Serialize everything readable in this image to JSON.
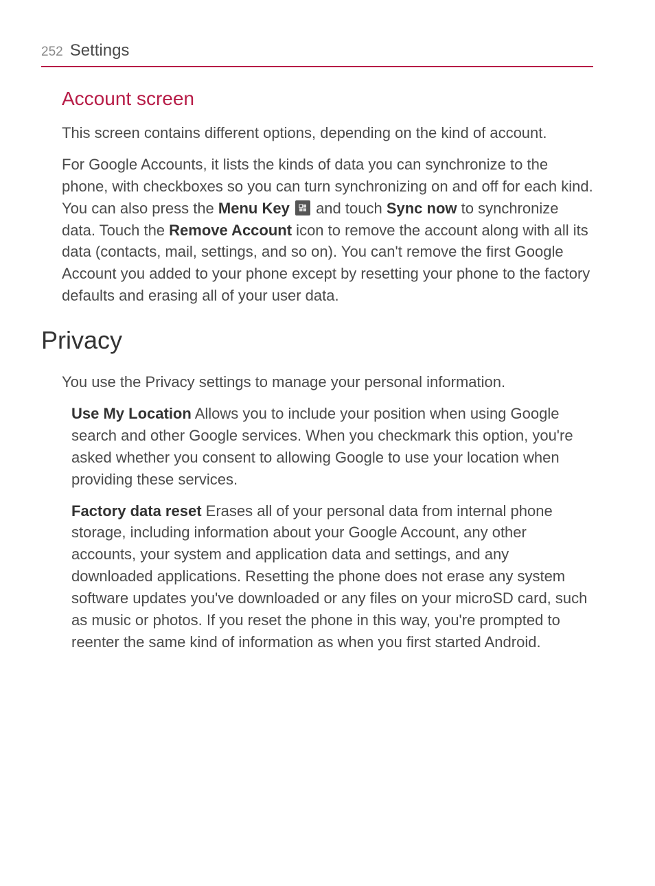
{
  "header": {
    "page_number": "252",
    "title": "Settings"
  },
  "section1": {
    "heading": "Account screen",
    "para1": "This screen contains different options, depending on the kind of account.",
    "para2_a": "For Google Accounts, it lists the kinds of data you can synchronize to the phone, with checkboxes so you can turn synchronizing on and off for each kind. You can also press the ",
    "para2_bold1": "Menu Key",
    "para2_b": " and touch ",
    "para2_bold2": "Sync now",
    "para2_c": " to synchronize data. Touch the ",
    "para2_bold3": "Remove Account",
    "para2_d": " icon to remove the account along with all its data (contacts, mail, settings, and so on). You can't remove the first Google Account you added to your phone except by resetting your phone to the factory defaults and erasing all of your user data."
  },
  "section2": {
    "heading": "Privacy",
    "intro": "You use the Privacy settings to manage your personal information.",
    "item1_bold": "Use My Location",
    "item1_text": " Allows you to include your position when using Google search and other Google services. When you checkmark this option, you're asked whether you consent to allowing Google to use your location when providing these services.",
    "item2_bold": "Factory data reset",
    "item2_text": " Erases all of your personal data from internal phone storage, including information about your Google Account, any other accounts, your system and application data and settings, and any downloaded applications. Resetting the phone does not erase any system software updates you've downloaded or any files on your microSD card, such as music or photos. If you reset the phone in this way, you're prompted to reenter the same kind of information as when you first started Android."
  }
}
